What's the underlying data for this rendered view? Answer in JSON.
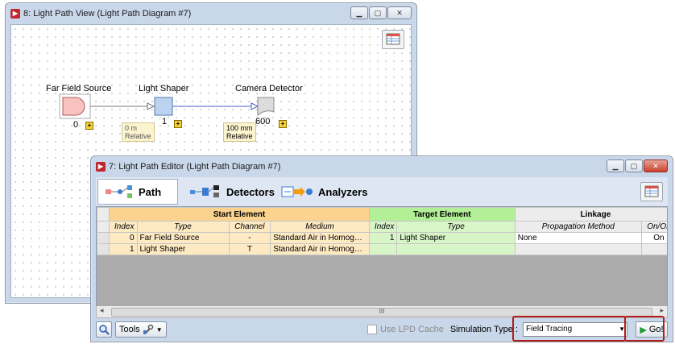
{
  "view_window": {
    "title": "8: Light Path View (Light Path Diagram #7)",
    "nodes": [
      {
        "label": "Far Field Source",
        "index": "0"
      },
      {
        "label": "Light Shaper",
        "index": "1"
      },
      {
        "label": "Camera Detector",
        "index": "600"
      }
    ],
    "links": [
      {
        "line1": "0 m",
        "line2": "Relative"
      },
      {
        "line1": "100 mm",
        "line2": "Relative"
      }
    ],
    "plus_label": "+"
  },
  "editor_window": {
    "title": "7: Light Path Editor (Light Path Diagram #7)",
    "tabs": [
      {
        "label": "Path"
      },
      {
        "label": "Detectors"
      },
      {
        "label": "Analyzers"
      }
    ],
    "table": {
      "groups": [
        "Start Element",
        "Target Element",
        "Linkage"
      ],
      "columns": [
        "Index",
        "Type",
        "Channel",
        "Medium",
        "Index",
        "Type",
        "Propagation Method",
        "On/Off"
      ],
      "rows": [
        [
          "0",
          "Far Field Source",
          "-",
          "Standard Air in Homogen...",
          "1",
          "Light Shaper",
          "None",
          "On"
        ],
        [
          "1",
          "Light Shaper",
          "T",
          "Standard Air in Homogen...",
          "",
          "",
          "",
          ""
        ]
      ]
    },
    "scroll_thumb_label": "III",
    "bottom": {
      "tools_label": "Tools",
      "use_lpd_cache_label": "Use LPD Cache",
      "simulation_type_label": "Simulation Type :",
      "simulation_type_value": "Field Tracing",
      "go_label": "Go!"
    }
  },
  "colors": {
    "start_header": "#fbd28e",
    "target_header": "#b3ef97",
    "highlight_box": "#b01e1e"
  }
}
